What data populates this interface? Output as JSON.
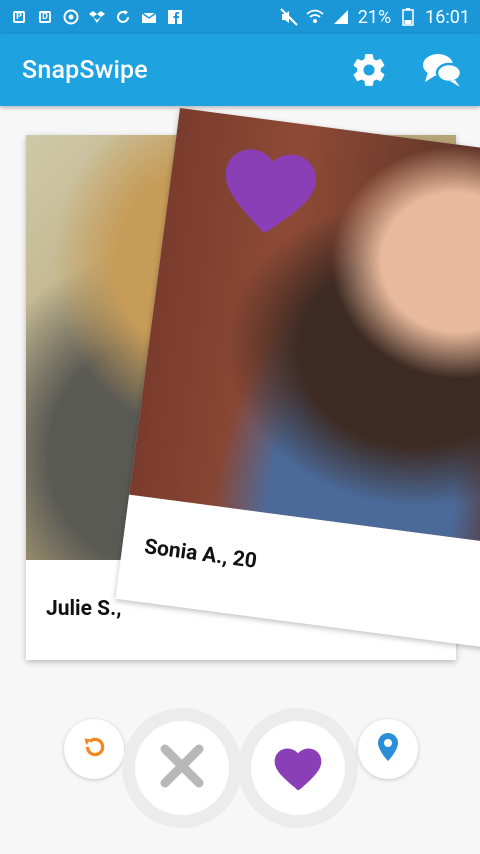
{
  "status_bar": {
    "battery_percent": "21%",
    "time": "16:01",
    "icons": [
      "notification-p-icon",
      "notification-d-icon",
      "whatsapp-icon",
      "dropbox-icon",
      "sync-icon",
      "mail-icon",
      "facebook-icon",
      "mute-icon",
      "wifi-icon",
      "signal-icon",
      "battery-icon"
    ]
  },
  "app_bar": {
    "title": "SnapSwipe",
    "settings_icon": "gear-icon",
    "chat_icon": "chat-bubbles-icon"
  },
  "cards": [
    {
      "name_label": "Julie S.,",
      "photo": "woman with long blonde hair, back turned"
    },
    {
      "name_label": "Sonia A., 20",
      "photo": "smiling woman with dark hair in denim top"
    }
  ],
  "like_indicator": {
    "icon": "heart-icon",
    "color": "#8b3fb7"
  },
  "actions": {
    "undo": {
      "icon": "undo-icon",
      "color": "#f08a1f"
    },
    "dislike": {
      "icon": "close-icon",
      "color": "#b8b8b8"
    },
    "like": {
      "icon": "heart-icon",
      "color": "#8b3fb7"
    },
    "location": {
      "icon": "location-pin-icon",
      "color": "#2a8fd6"
    }
  },
  "colors": {
    "status_bar": "#1b96d6",
    "app_bar": "#1fa3e0",
    "accent": "#8b3fb7"
  }
}
